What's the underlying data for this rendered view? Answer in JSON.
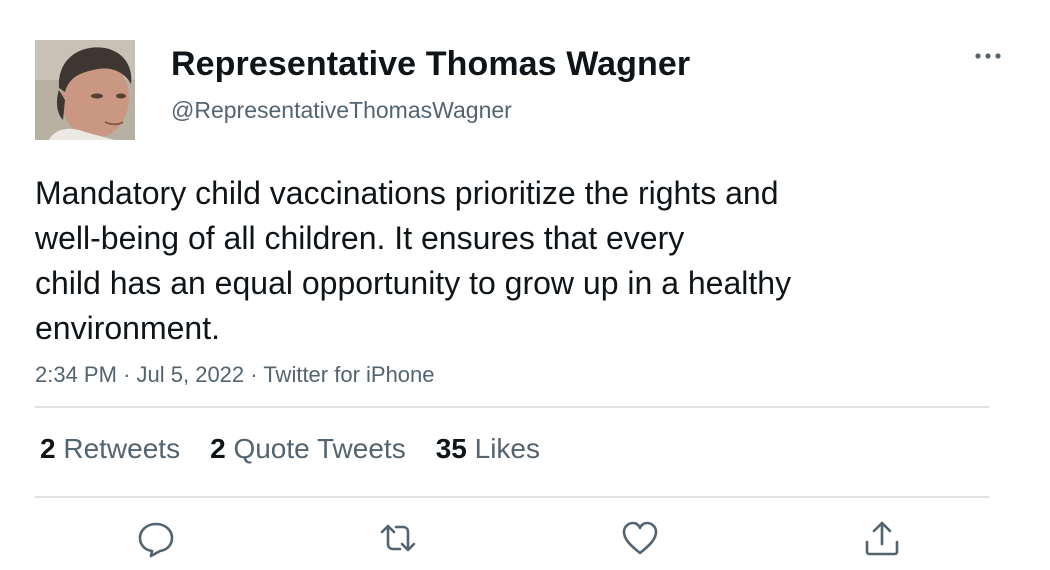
{
  "tweet": {
    "author": {
      "display_name": "Representative Thomas Wagner",
      "handle": "@RepresentativeThomasWagner"
    },
    "text_lines": [
      "Mandatory child vaccinations prioritize the rights and",
      "well-being of all children. It ensures that every",
      "child has an equal opportunity to grow up in a healthy",
      "environment."
    ],
    "time": "2:34 PM",
    "date": "Jul 5, 2022",
    "source": "Twitter for iPhone",
    "separator": "·",
    "stats": {
      "retweets": {
        "count": "2",
        "label": "Retweets"
      },
      "quote_tweets": {
        "count": "2",
        "label": "Quote Tweets"
      },
      "likes": {
        "count": "35",
        "label": "Likes"
      }
    }
  },
  "icons": {
    "more": "more-horizontal-icon",
    "reply": "reply-icon",
    "retweet": "retweet-icon",
    "like": "heart-icon",
    "share": "share-icon"
  },
  "colors": {
    "text_primary": "#0f1419",
    "text_secondary": "#536471",
    "divider": "#dfe3e6",
    "icon": "#536471"
  }
}
